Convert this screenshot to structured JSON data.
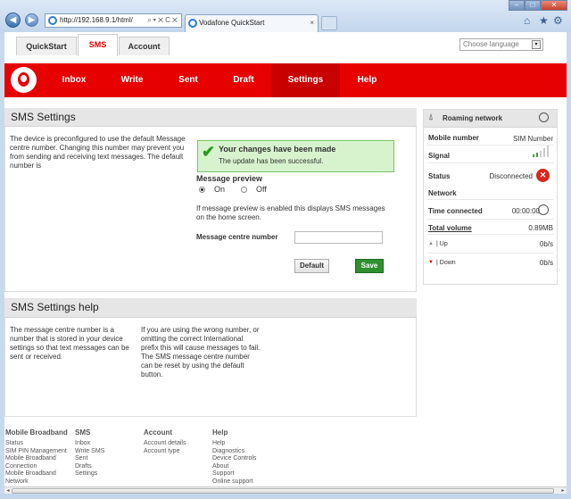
{
  "browser": {
    "url": "http://192.168.9.1/html/",
    "tab_title": "Vodafone QuickStart",
    "tab_close": "×",
    "back_glyph": "◀",
    "forward_glyph": "▶",
    "address_tools": "⌕▾✕C✕",
    "window_controls": [
      "–",
      "□",
      "✕"
    ],
    "toolbar_icons": [
      "home-icon",
      "star-icon",
      "gear-icon"
    ]
  },
  "top_tabs": [
    {
      "label": "QuickStart",
      "active": false
    },
    {
      "label": "SMS",
      "active": true
    },
    {
      "label": "Account",
      "active": false
    }
  ],
  "language": {
    "placeholder": "Choose language",
    "arrow": "▾"
  },
  "navbar": {
    "items": [
      "Inbox",
      "Write",
      "Sent",
      "Draft",
      "Settings",
      "Help"
    ],
    "active": "Settings",
    "brand_color": "#e60000"
  },
  "settings": {
    "title": "SMS Settings",
    "description": "The device is preconfigured to use the default Message centre number. Changing this number may prevent you from sending and receiving text messages. The default number is",
    "success_title": "Your changes have been made",
    "success_text": "The update has been successful.",
    "success_check": "✔",
    "preview_label": "Message preview",
    "on_label": "On",
    "off_label": "Off",
    "preview_on": true,
    "preview_note": "If message preview is enabled this displays SMS messages on the home screen.",
    "mcn_label": "Message centre number",
    "mcn_value": "",
    "default_button": "Default",
    "save_button": "Save"
  },
  "help": {
    "title": "SMS Settings help",
    "col1": "The message centre number is a number that is stored in your device settings so that text messages can be sent or received.",
    "col2": "If you are using the wrong number, or omitting the correct International prefix this will cause messages to fail. The SMS message centre number can be reset by using the default button."
  },
  "status": {
    "title": "Roaming network",
    "mobile_number_label": "Mobile number",
    "mobile_number_value": "SIM Number",
    "signal_label": "Signal",
    "status_label": "Status",
    "status_value": "Disconnected",
    "network_label": "Network",
    "time_label": "Time connected",
    "time_value": "00:00:00",
    "volume_label": "Total volume",
    "volume_value": "0.89MB",
    "up_label": "| Up",
    "up_value": "0b/s",
    "down_label": "| Down",
    "down_value": "0b/s",
    "disconnect_glyph": "✕",
    "up_arrow": "▲",
    "down_arrow": "▼"
  },
  "footer": {
    "columns": [
      {
        "title": "Mobile Broadband",
        "links": [
          "Status",
          "SIM PIN Management",
          "Mobile Broadband",
          "Connection",
          "Mobile Broadband",
          "Network"
        ]
      },
      {
        "title": "SMS",
        "links": [
          "Inbox",
          "Write SMS",
          "Sent",
          "Drafts",
          "Settings"
        ]
      },
      {
        "title": "Account",
        "links": [
          "Account details",
          "Account type"
        ]
      },
      {
        "title": "Help",
        "links": [
          "Help",
          "Diagnostics",
          "Device Controls",
          "About",
          "Support",
          "Online support"
        ]
      }
    ]
  },
  "scrollbar": {
    "left_arrow": "◂",
    "right_arrow": "▸"
  }
}
